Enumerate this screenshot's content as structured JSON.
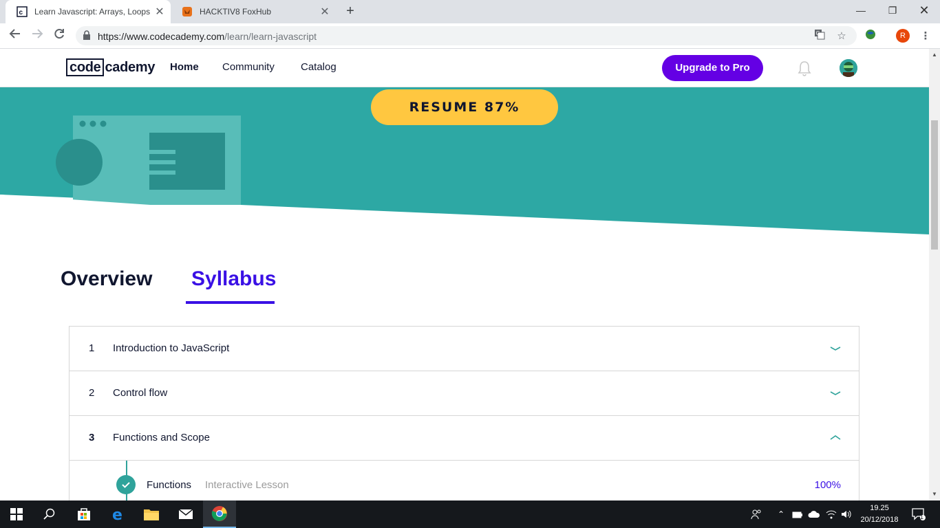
{
  "browser": {
    "tabs": [
      {
        "title": "Learn Javascript: Arrays, Loops &",
        "favicon": "codecademy-favicon",
        "active": true
      },
      {
        "title": "HACKTIV8 FoxHub",
        "favicon": "foxhub-favicon",
        "active": false
      }
    ],
    "url_host": "https://www.codecademy.com",
    "url_path": "/learn/learn-javascript",
    "profile_initial": "R"
  },
  "site": {
    "logo_boxed": "code",
    "logo_rest": "cademy",
    "nav": [
      "Home",
      "Community",
      "Catalog"
    ],
    "upgrade_label": "Upgrade to Pro"
  },
  "hero": {
    "resume_label": "RESUME 87%",
    "accent_color": "#2da8a4"
  },
  "course_tabs": {
    "overview": "Overview",
    "syllabus": "Syllabus",
    "active": "Syllabus"
  },
  "syllabus": {
    "modules": [
      {
        "number": "1",
        "title": "Introduction to JavaScript",
        "expanded": false
      },
      {
        "number": "2",
        "title": "Control flow",
        "expanded": false
      },
      {
        "number": "3",
        "title": "Functions and Scope",
        "expanded": true
      }
    ],
    "lessons": [
      {
        "title": "Functions",
        "type": "Interactive Lesson",
        "progress": "100%",
        "completed": true
      }
    ]
  },
  "taskbar": {
    "time": "19.25",
    "date": "20/12/2018",
    "notification_count": "1"
  },
  "colors": {
    "brand_purple": "#6400e4",
    "syllabus_blue": "#3a10e5",
    "resume_yellow": "#ffc740",
    "teal": "#2fa39b"
  }
}
